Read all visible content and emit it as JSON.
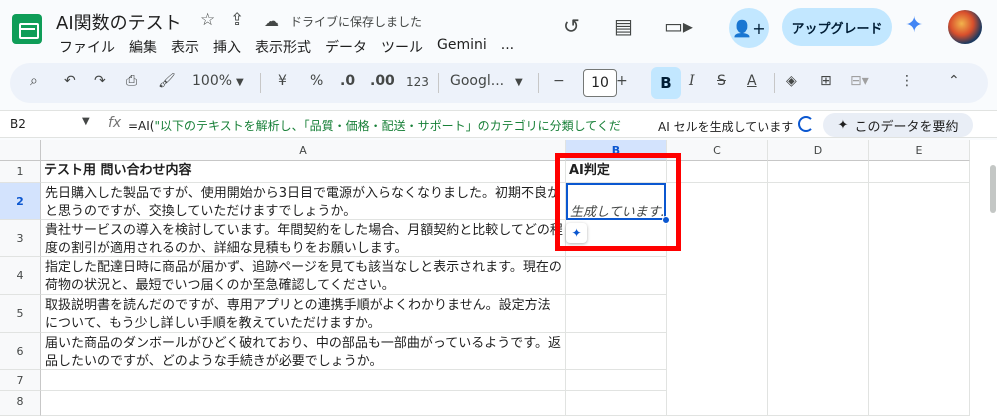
{
  "app": {
    "doc_title": "AI関数のテスト",
    "saved_status": "ドライブに保存しました",
    "menu": [
      "ファイル",
      "編集",
      "表示",
      "挿入",
      "表示形式",
      "データ",
      "ツール",
      "Gemini",
      "..."
    ],
    "upgrade_label": "アップグレード"
  },
  "toolbar": {
    "zoom": "100%",
    "currency": "¥",
    "percent": "%",
    "dec_decrease": ".0",
    "dec_increase": ".00",
    "number_format": "123",
    "font": "Googl...",
    "font_size": "10",
    "bold": "B",
    "italic": "I",
    "strike": "S",
    "text_color": "A"
  },
  "formula_bar": {
    "cell_ref": "B2",
    "fx": "fx",
    "formula_prefix": "=AI(",
    "formula_string": "\"以下のテキストを解析し、「品質・価格・配送・サポート」のカテゴリに分類してくだ",
    "ai_status": "AI セルを生成しています",
    "summarize": "このデータを要約"
  },
  "grid": {
    "columns": [
      "A",
      "B",
      "C",
      "D",
      "E"
    ],
    "rows": [
      "1",
      "2",
      "3",
      "4",
      "5",
      "6",
      "7",
      "8"
    ],
    "a1": "テスト用 問い合わせ内容",
    "b1": "AI判定",
    "b2": "生成しています...",
    "a_values": [
      "先日購入した製品ですが、使用開始から3日目で電源が入らなくなりました。初期不良かと思うのですが、交換していただけますでしょうか。",
      "貴社サービスの導入を検討しています。年間契約をした場合、月額契約と比較してどの程度の割引が適用されるのか、詳細な見積もりをお願いします。",
      "指定した配達日時に商品が届かず、追跡ページを見ても該当なしと表示されます。現在の荷物の状況と、最短でいつ届くのか至急確認してください。",
      "取扱説明書を読んだのですが、専用アプリとの連携手順がよくわかりません。設定方法について、もう少し詳しい手順を教えていただけますか。",
      "届いた商品のダンボールがひどく破れており、中の部品も一部曲がっているようです。返品したいのですが、どのような手続きが必要でしょうか。"
    ]
  }
}
